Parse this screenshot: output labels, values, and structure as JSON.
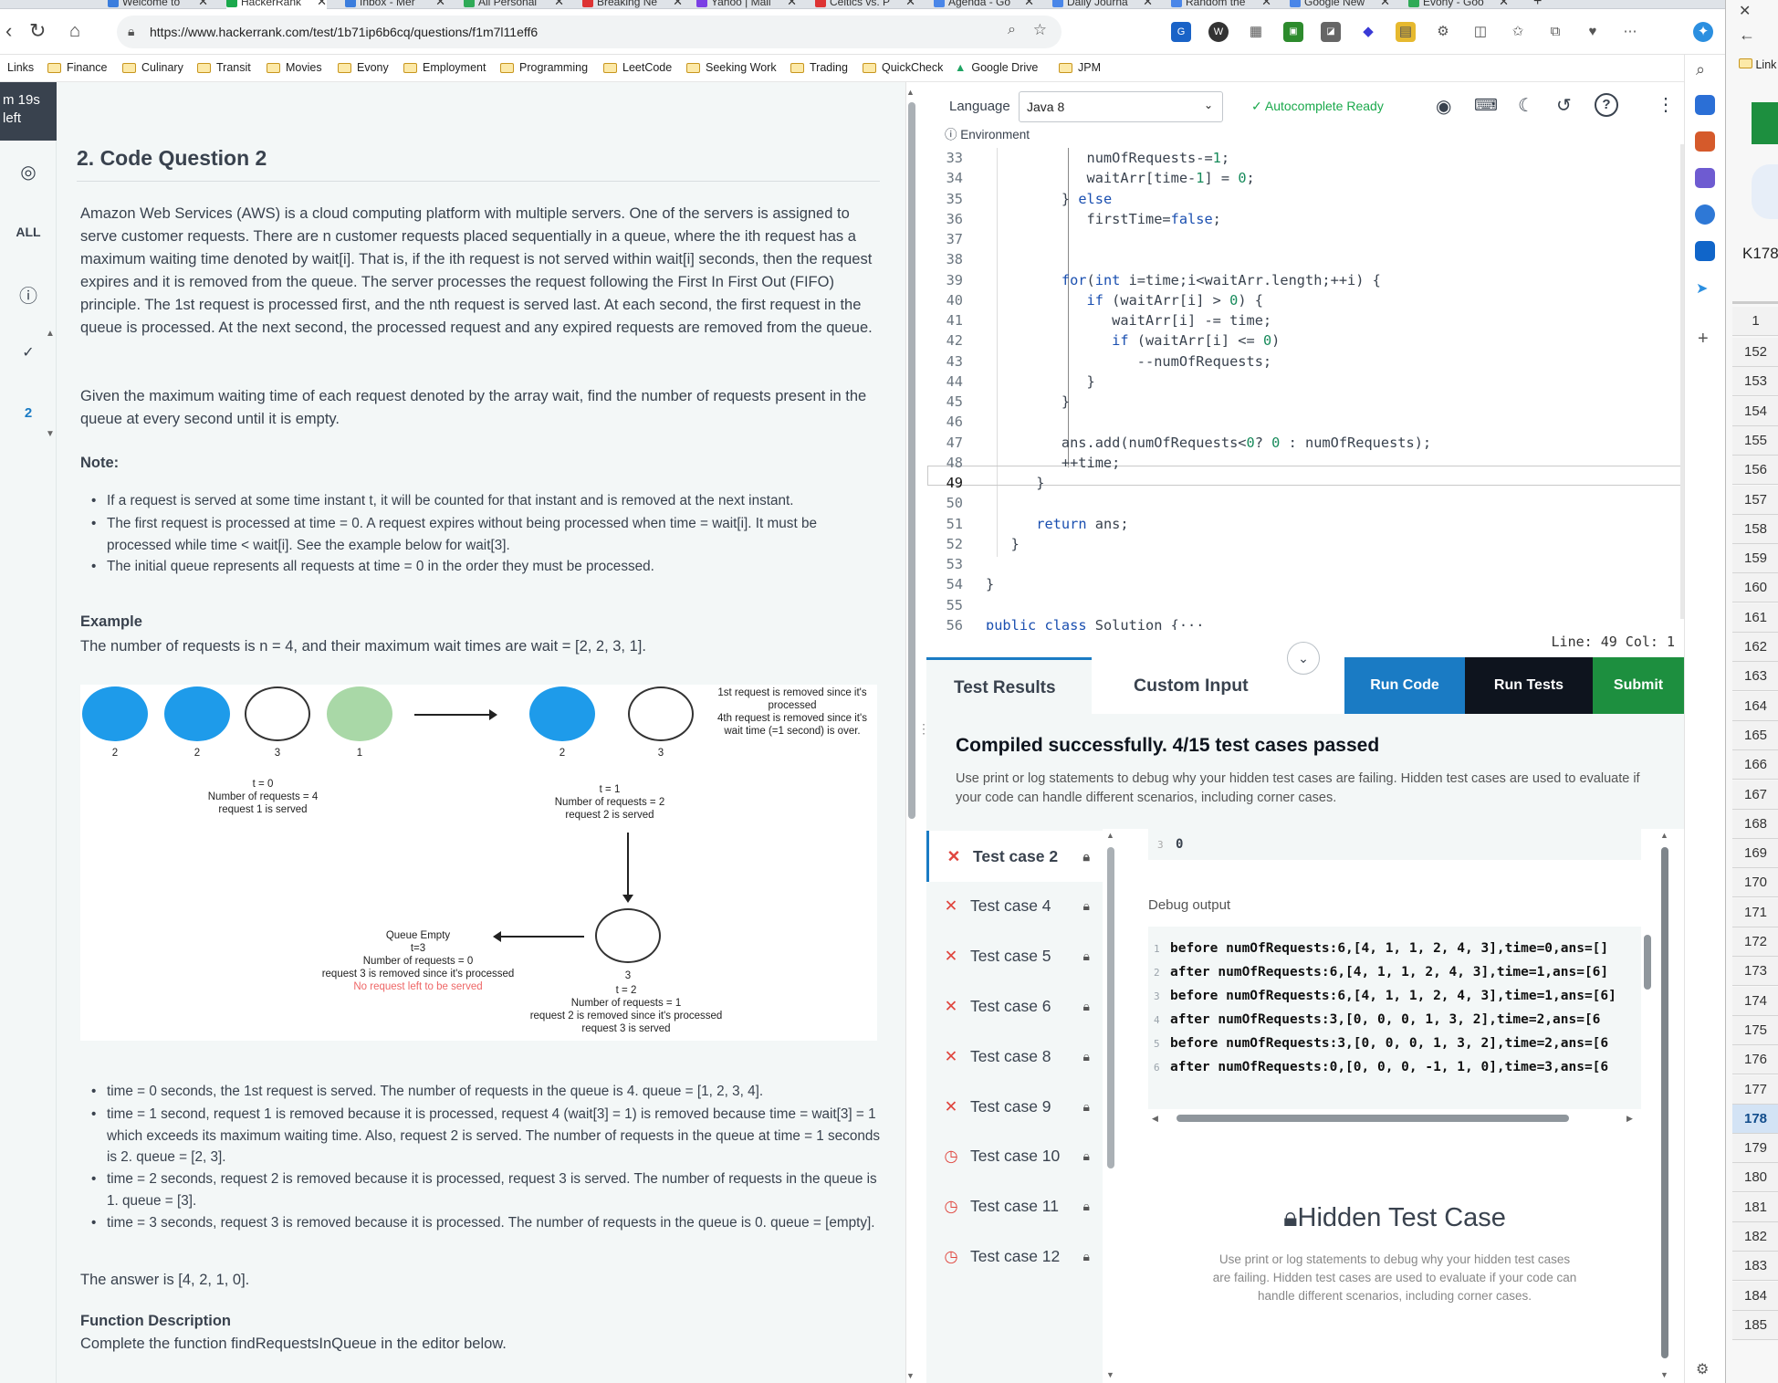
{
  "browser": {
    "tabs": [
      "Welcome to",
      "HackerRank",
      "Inbox - Mer",
      "All Personal",
      "Breaking Ne",
      "Yahoo | Mail",
      "Celtics vs. P",
      "Agenda - Go",
      "Daily Journa",
      "Random the",
      "Google New",
      "Evony - Goo"
    ],
    "url": "https://www.hackerrank.com/test/1b71ip6b6cq/questions/f1m7l11eff6",
    "bookmarks": [
      "Links",
      "Finance",
      "Culinary",
      "Transit",
      "Movies",
      "Evony",
      "Employment",
      "Programming",
      "LeetCode",
      "Seeking Work",
      "Trading",
      "QuickCheck",
      "Google Drive",
      "JPM"
    ],
    "right_link": "Link"
  },
  "rail": {
    "timer": "m 19s left",
    "all_label": "ALL",
    "current_number": "2"
  },
  "question": {
    "title": "2. Code Question 2",
    "intro_p1": "Amazon Web Services (AWS) is a cloud computing platform with multiple servers. One of the servers is assigned to serve customer requests. There are n customer requests placed sequentially in a queue, where the ith request has a maximum waiting time denoted by wait[i]. That is, if the ith request is not served within wait[i] seconds, then the request expires and it is removed from the queue. The server processes the request following the First In First Out (FIFO) principle.  The 1st request is processed first, and the nth request is served last. At each second, the first request in the queue is processed. At the next second, the processed request and any expired requests are removed from the queue.",
    "intro_p2": "Given the maximum waiting time of each request denoted by the array wait, find the number of requests present in the queue at every second until it is empty.",
    "note_heading": "Note:",
    "notes": [
      "If a request is served at some time instant t, it will be counted for that instant and is removed at the next instant.",
      "The first request is processed at time = 0. A request expires without being processed when time = wait[i]. It must be processed while time < wait[i]. See the example below for wait[3].",
      "The initial queue represents all requests at time = 0 in the order they must be processed."
    ],
    "example_heading": "Example",
    "example_text": "The number of requests is n = 4, and their maximum wait times are wait = [2, 2, 3, 1].",
    "diagram": {
      "t0_values": [
        "2",
        "2",
        "3",
        "1"
      ],
      "t0_caption": [
        "t = 0",
        "Number of requests = 4",
        "request 1 is served"
      ],
      "t1_values": [
        "2",
        "3"
      ],
      "t1_note": [
        "1st request is removed since it's",
        "processed",
        "4th request is removed since it's",
        "wait time (=1 second) is over."
      ],
      "t1_caption": [
        "t = 1",
        "Number of requests = 2",
        "request 2 is served"
      ],
      "t2_value": "3",
      "t2_caption": [
        "t = 2",
        "Number of requests = 1",
        "request 2 is removed since it's processed",
        "request 3 is served"
      ],
      "t3_caption": [
        "Queue Empty",
        "t=3",
        "Number of requests = 0",
        "request 3 is removed since it's processed"
      ],
      "t3_red": "No request left to be served"
    },
    "steps": [
      "time = 0 seconds, the 1st request is served.  The number of requests in the queue is 4. queue = [1, 2, 3, 4].",
      "time = 1 second, request 1 is removed because it is processed, request 4 (wait[3] = 1) is removed because time = wait[3] = 1 which exceeds its maximum waiting time. Also, request 2 is served. The number of requests in the queue at time = 1 seconds is 2. queue = [2, 3].",
      "time = 2 seconds, request 2 is removed because it is processed, request 3 is served. The number of requests in the queue is 1. queue = [3].",
      "time = 3 seconds, request 3 is removed because it is processed. The number of requests in the queue is 0. queue = [empty]."
    ],
    "answer": "The answer is [4, 2, 1, 0].",
    "function_heading": "Function Description",
    "function_text": "Complete the function findRequestsInQueue in the editor below."
  },
  "editor": {
    "language_label": "Language",
    "language": "Java 8",
    "autocomplete": "Autocomplete Ready",
    "environment": "Environment",
    "lines": [
      {
        "n": "33",
        "t": "            numOfRequests-=1;"
      },
      {
        "n": "34",
        "t": "            waitArr[time-1] = 0;"
      },
      {
        "n": "35",
        "t": "         } else"
      },
      {
        "n": "36",
        "t": "            firstTime=false;"
      },
      {
        "n": "37",
        "t": ""
      },
      {
        "n": "38",
        "t": ""
      },
      {
        "n": "39",
        "t": "         for(int i=time;i<waitArr.length;++i) {"
      },
      {
        "n": "40",
        "t": "            if (waitArr[i] > 0) {"
      },
      {
        "n": "41",
        "t": "               waitArr[i] -= time;"
      },
      {
        "n": "42",
        "t": "               if (waitArr[i] <= 0)"
      },
      {
        "n": "43",
        "t": "                  --numOfRequests;"
      },
      {
        "n": "44",
        "t": "            }"
      },
      {
        "n": "45",
        "t": "         }"
      },
      {
        "n": "46",
        "t": ""
      },
      {
        "n": "47",
        "t": "         ans.add(numOfRequests<0? 0 : numOfRequests);"
      },
      {
        "n": "48",
        "t": "         ++time;"
      },
      {
        "n": "49",
        "t": "      }"
      },
      {
        "n": "50",
        "t": ""
      },
      {
        "n": "51",
        "t": "      return ans;"
      },
      {
        "n": "52",
        "t": "   }"
      },
      {
        "n": "53",
        "t": ""
      },
      {
        "n": "54",
        "t": "}"
      },
      {
        "n": "55",
        "t": ""
      },
      {
        "n": "56",
        "t": "public class Solution {···"
      }
    ],
    "status": "Line: 49 Col: 1"
  },
  "results": {
    "tab_results": "Test Results",
    "tab_custom": "Custom Input",
    "run_code": "Run Code",
    "run_tests": "Run Tests",
    "submit": "Submit",
    "compiled": "Compiled successfully. 4/15 test cases passed",
    "compiled_note": "Use print or log statements to debug why your hidden test cases are failing. Hidden test cases are used to evaluate if your code can handle different scenarios, including corner cases.",
    "test_cases": [
      {
        "label": "Test case 2",
        "status": "fail"
      },
      {
        "label": "Test case 4",
        "status": "fail"
      },
      {
        "label": "Test case 5",
        "status": "fail"
      },
      {
        "label": "Test case 6",
        "status": "fail"
      },
      {
        "label": "Test case 8",
        "status": "fail"
      },
      {
        "label": "Test case 9",
        "status": "fail"
      },
      {
        "label": "Test case 10",
        "status": "pending"
      },
      {
        "label": "Test case 11",
        "status": "pending"
      },
      {
        "label": "Test case 12",
        "status": "pending"
      }
    ],
    "output_line_num": "3",
    "output_value": "0",
    "debug_heading": "Debug output",
    "debug_lines": [
      {
        "n": "1",
        "t": "before numOfRequests:6,[4, 1, 1, 2, 4, 3],time=0,ans=[]"
      },
      {
        "n": "2",
        "t": "after numOfRequests:6,[4, 1, 1, 2, 4, 3],time=1,ans=[6]"
      },
      {
        "n": "3",
        "t": "before numOfRequests:6,[4, 1, 1, 2, 4, 3],time=1,ans=[6]"
      },
      {
        "n": "4",
        "t": "after numOfRequests:3,[0, 0, 0, 1, 3, 2],time=2,ans=[6"
      },
      {
        "n": "5",
        "t": "before numOfRequests:3,[0, 0, 0, 1, 3, 2],time=2,ans=[6"
      },
      {
        "n": "6",
        "t": "after numOfRequests:0,[0, 0, 0, -1, 1, 0],time=3,ans=[6"
      }
    ],
    "hidden_title": "Hidden Test Case",
    "hidden_text": "Use print or log statements to debug why your hidden test cases are failing. Hidden test cases are used to evaluate if your code can handle different scenarios, including corner cases."
  },
  "excel": {
    "cell": "K178",
    "first_row": "1",
    "rows": [
      "152",
      "153",
      "154",
      "155",
      "156",
      "157",
      "158",
      "159",
      "160",
      "161",
      "162",
      "163",
      "164",
      "165",
      "166",
      "167",
      "168",
      "169",
      "170",
      "171",
      "172",
      "173",
      "174",
      "175",
      "176",
      "177",
      "178",
      "179",
      "180",
      "181",
      "182",
      "183",
      "184",
      "185"
    ],
    "selected_row": "178"
  },
  "colors": {
    "run_code": "#1a7bc4",
    "run_tests": "#0e141e",
    "submit": "#1d8f3f",
    "fail": "#e0463f",
    "pending": "#e0463f",
    "pass": "#1ba94c",
    "cloud_blue": "#1e9bea",
    "cloud_green": "#a9d8a7"
  }
}
